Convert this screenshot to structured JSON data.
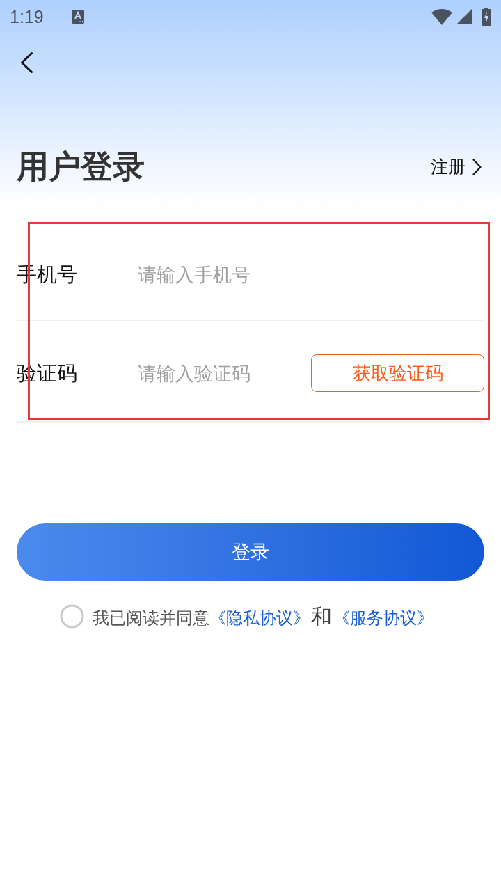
{
  "status_bar": {
    "time": "1:19"
  },
  "header": {
    "title": "用户登录",
    "register_link": "注册"
  },
  "form": {
    "highlighted": true,
    "fields": [
      {
        "kind": "phone",
        "label": "手机号",
        "placeholder": "请输入手机号"
      },
      {
        "kind": "code",
        "label": "验证码",
        "placeholder": "请输入验证码",
        "action": "获取验证码"
      }
    ]
  },
  "login_button": "登录",
  "agreement": {
    "checked": false,
    "parts": [
      {
        "kind": "text",
        "text": "我已阅读并同意"
      },
      {
        "kind": "link",
        "text": "《隐私协议》"
      },
      {
        "kind": "joiner",
        "text": "和"
      },
      {
        "kind": "link",
        "text": "《服务协议》"
      }
    ]
  }
}
